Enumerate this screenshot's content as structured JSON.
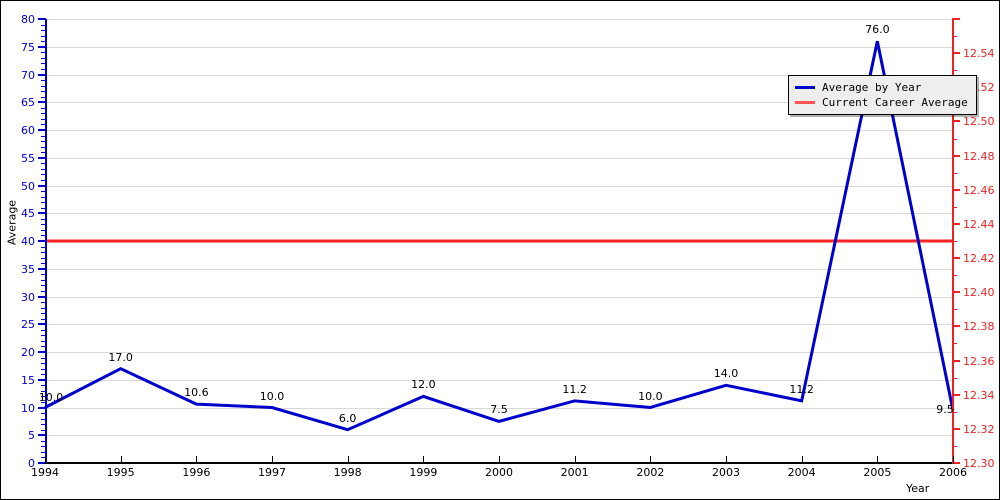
{
  "chart_data": {
    "type": "line",
    "title": "",
    "xlabel": "Year",
    "ylabel": "Average",
    "grid": true,
    "legend_position": "top-right",
    "categories": [
      "1994",
      "1995",
      "1996",
      "1997",
      "1998",
      "1999",
      "2000",
      "2001",
      "2002",
      "2003",
      "2004",
      "2005",
      "2006"
    ],
    "series": [
      {
        "name": "Average by Year",
        "color": "#0000cc",
        "axis": "left",
        "values": [
          10.0,
          17.0,
          10.6,
          10.0,
          6.0,
          12.0,
          7.5,
          11.2,
          10.0,
          14.0,
          11.2,
          76.0,
          9.5
        ],
        "labels": [
          "10.0",
          "17.0",
          "10.6",
          "10.0",
          "6.0",
          "12.0",
          "7.5",
          "11.2",
          "10.0",
          "14.0",
          "11.2",
          "76.0",
          "9.5"
        ]
      },
      {
        "name": "Current Career Average",
        "color": "#ff2222",
        "axis": "left",
        "constant_value": 40.0
      }
    ],
    "left_axis": {
      "label": "Average",
      "color": "#0000cc",
      "min": 0,
      "max": 80,
      "tick_step": 5,
      "minor_step": 1,
      "ticks": [
        "0",
        "5",
        "10",
        "15",
        "20",
        "25",
        "30",
        "35",
        "40",
        "45",
        "50",
        "55",
        "60",
        "65",
        "70",
        "75",
        "80"
      ]
    },
    "right_axis": {
      "color": "#ee2222",
      "min": 12.3,
      "max": 12.56,
      "tick_step": 0.02,
      "ticks": [
        "12.30",
        "12.32",
        "12.34",
        "12.36",
        "12.38",
        "12.40",
        "12.42",
        "12.44",
        "12.46",
        "12.48",
        "12.50",
        "12.52",
        "12.54"
      ]
    },
    "x_axis": {
      "label": "Year",
      "color": "#000000",
      "ticks": [
        "1994",
        "1995",
        "1996",
        "1997",
        "1998",
        "1999",
        "2000",
        "2001",
        "2002",
        "2003",
        "2004",
        "2005",
        "2006"
      ]
    }
  },
  "legend": {
    "items": [
      {
        "label": "Average by Year",
        "color": "#0000cc"
      },
      {
        "label": "Current Career Average",
        "color": "#ff5555"
      }
    ]
  }
}
